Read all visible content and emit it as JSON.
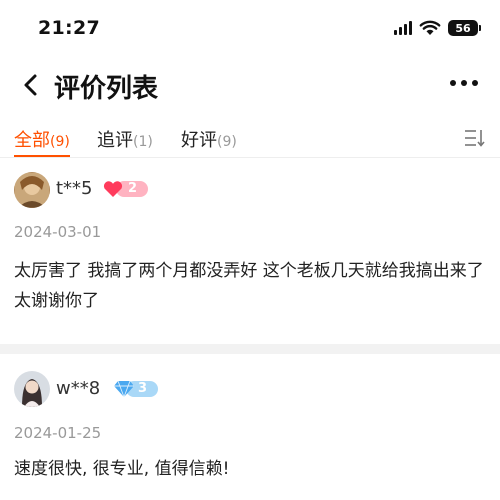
{
  "status_bar": {
    "time": "21:27",
    "battery": "56"
  },
  "nav": {
    "title": "评价列表"
  },
  "tabs": [
    {
      "label": "全部",
      "count": "(9)",
      "active": true
    },
    {
      "label": "追评",
      "count": "(1)",
      "active": false
    },
    {
      "label": "好评",
      "count": "(9)",
      "active": false
    }
  ],
  "reviews": [
    {
      "username": "t**5",
      "badge_icon": "heart-icon",
      "badge_level": "2",
      "date": "2024-03-01",
      "text": "太厉害了 我搞了两个月都没弄好 这个老板几天就给我搞出来了 太谢谢你了"
    },
    {
      "username": "w**8",
      "badge_icon": "diamond-icon",
      "badge_level": "3",
      "date": "2024-01-25",
      "text": "速度很快, 很专业, 值得信赖!"
    }
  ],
  "colors": {
    "accent": "#ff5000",
    "muted_text": "#999999",
    "heart_badge": "#ff3b5c",
    "diamond_badge": "#4aa8f0"
  }
}
